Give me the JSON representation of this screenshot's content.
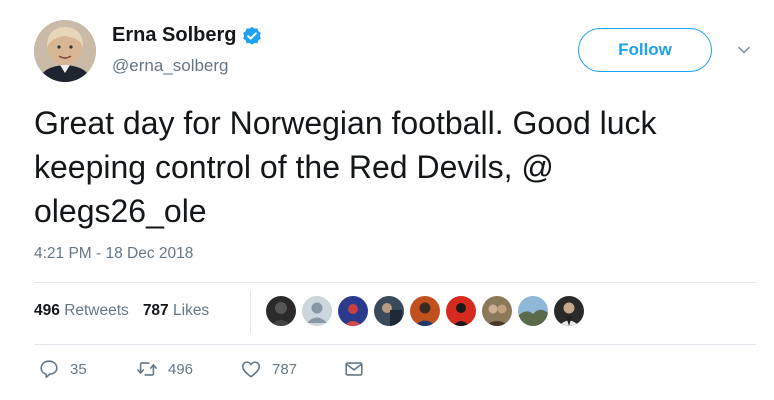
{
  "author": {
    "name": "Erna Solberg",
    "handle": "@erna_solberg",
    "verified": true
  },
  "follow_label": "Follow",
  "tweet": {
    "text_line1": "Great day for Norwegian football. Good luck",
    "text_line2": "keeping control of the Red Devils, @",
    "text_line3": "olegs26_ole",
    "timestamp": "4:21 PM - 18 Dec 2018"
  },
  "stats": {
    "retweets_count": "496",
    "retweets_label": "Retweets",
    "likes_count": "787",
    "likes_label": "Likes"
  },
  "actions": {
    "reply_count": "35",
    "retweet_count": "496",
    "like_count": "787"
  },
  "colors": {
    "accent": "#1da1f2",
    "muted": "#657786",
    "text": "#14171a",
    "divider": "#e1e8ed"
  }
}
